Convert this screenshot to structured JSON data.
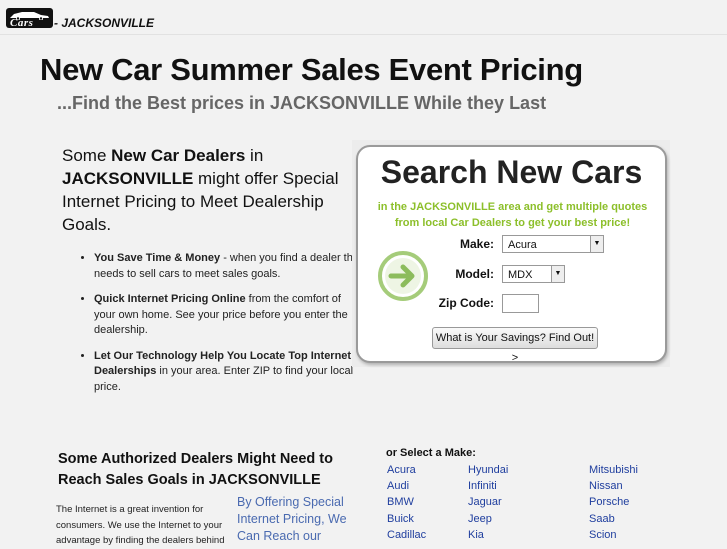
{
  "header": {
    "logo_text": "Cars",
    "city_label": "- JACKSONVILLE"
  },
  "main": {
    "title": "New Car Summer Sales Event Pricing",
    "subtitle": "...Find the Best prices in JACKSONVILLE While they Last",
    "intro": {
      "p1": "Some ",
      "b1": "New Car Dealers",
      "p2": " in ",
      "b2": "JACKSONVILLE",
      "p3": " might offer Special Internet Pricing to Meet Dealership Goals."
    },
    "benefits": [
      {
        "bold": "You Save Time & Money",
        "text": " - when you find a dealer that needs to sell cars to meet sales goals."
      },
      {
        "bold": "Quick Internet Pricing Online",
        "text": " from the comfort of your own home. See your price before you enter the dealership."
      },
      {
        "bold": "Let Our Technology Help You Locate Top Internet Dealerships",
        "text": " in your area. Enter ZIP to find your local price."
      }
    ]
  },
  "search_panel": {
    "title": "Search New Cars",
    "subtitle": "in the JACKSONVILLE area and get multiple quotes from local Car Dealers to get your best price!",
    "make_label": "Make:",
    "make_value": "Acura",
    "model_label": "Model:",
    "model_value": "MDX",
    "zip_label": "Zip Code:",
    "zip_value": "",
    "submit_label": "What is Your Savings? Find Out! >",
    "arrow_icon": "arrow-right-circle-icon",
    "accent_color": "#8cbf2a"
  },
  "lower": {
    "authorized_heading": "Some Authorized Dealers Might Need to Reach Sales Goals in JACKSONVILLE",
    "internet_para": "The Internet is a great invention for consumers. We use the Internet to your advantage by finding the dealers behind",
    "offering_text": "By Offering Special Internet Pricing, We Can Reach our",
    "or_select_label": "or Select a Make:",
    "makes_col1": [
      "Acura",
      "Audi",
      "BMW",
      "Buick",
      "Cadillac"
    ],
    "makes_col2": [
      "Hyundai",
      "Infiniti",
      "Jaguar",
      "Jeep",
      "Kia"
    ],
    "makes_col3": [
      "Mitsubishi",
      "Nissan",
      "Porsche",
      "Saab",
      "Scion"
    ]
  }
}
